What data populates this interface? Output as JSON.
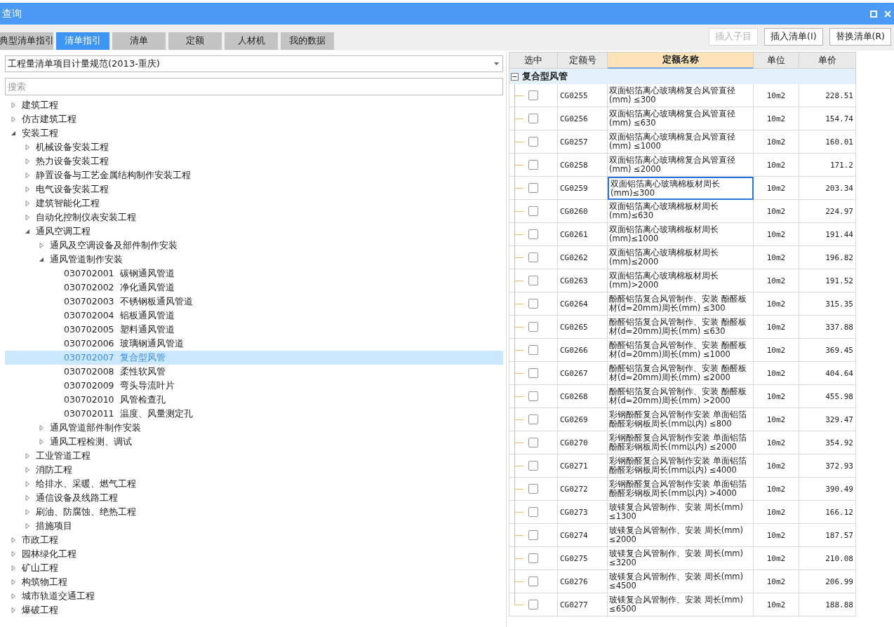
{
  "window": {
    "title": "查询"
  },
  "tabs": [
    {
      "label": "典型清单指引",
      "selected": false
    },
    {
      "label": "清单指引",
      "selected": true
    },
    {
      "label": "清单",
      "selected": false
    },
    {
      "label": "定额",
      "selected": false
    },
    {
      "label": "人材机",
      "selected": false
    },
    {
      "label": "我的数据",
      "selected": false
    }
  ],
  "actions": [
    {
      "label": "插入子目",
      "disabled": true
    },
    {
      "label": "插入清单(I)",
      "disabled": false
    },
    {
      "label": "替换清单(R)",
      "disabled": false
    }
  ],
  "spec_select": {
    "value": "工程量清单项目计量规范(2013-重庆)"
  },
  "search": {
    "placeholder": "搜索"
  },
  "tree": [
    {
      "label": "建筑工程",
      "expanded": false
    },
    {
      "label": "仿古建筑工程",
      "expanded": false
    },
    {
      "label": "安装工程",
      "expanded": true,
      "children": [
        {
          "label": "机械设备安装工程",
          "expanded": false
        },
        {
          "label": "热力设备安装工程",
          "expanded": false
        },
        {
          "label": "静置设备与工艺金属结构制作安装工程",
          "expanded": false
        },
        {
          "label": "电气设备安装工程",
          "expanded": false
        },
        {
          "label": "建筑智能化工程",
          "expanded": false
        },
        {
          "label": "自动化控制仪表安装工程",
          "expanded": false
        },
        {
          "label": "通风空调工程",
          "expanded": true,
          "children": [
            {
              "label": "通风及空调设备及部件制作安装",
              "expanded": false
            },
            {
              "label": "通风管道制作安装",
              "expanded": true,
              "children": [
                {
                  "code": "030702001",
                  "label": "碳钢通风管道",
                  "selected": false
                },
                {
                  "code": "030702002",
                  "label": "净化通风管道",
                  "selected": false
                },
                {
                  "code": "030702003",
                  "label": "不锈钢板通风管道",
                  "selected": false
                },
                {
                  "code": "030702004",
                  "label": "铝板通风管道",
                  "selected": false
                },
                {
                  "code": "030702005",
                  "label": "塑料通风管道",
                  "selected": false
                },
                {
                  "code": "030702006",
                  "label": "玻璃钢通风管道",
                  "selected": false
                },
                {
                  "code": "030702007",
                  "label": "复合型风管",
                  "selected": true
                },
                {
                  "code": "030702008",
                  "label": "柔性软风管",
                  "selected": false
                },
                {
                  "code": "030702009",
                  "label": "弯头导流叶片",
                  "selected": false
                },
                {
                  "code": "030702010",
                  "label": "风管检查孔",
                  "selected": false
                },
                {
                  "code": "030702011",
                  "label": "温度、风量测定孔",
                  "selected": false
                }
              ]
            },
            {
              "label": "通风管道部件制作安装",
              "expanded": false
            },
            {
              "label": "通风工程检测、调试",
              "expanded": false
            }
          ]
        },
        {
          "label": "工业管道工程",
          "expanded": false
        },
        {
          "label": "消防工程",
          "expanded": false
        },
        {
          "label": "给排水、采暖、燃气工程",
          "expanded": false
        },
        {
          "label": "通信设备及线路工程",
          "expanded": false
        },
        {
          "label": "刷油、防腐蚀、绝热工程",
          "expanded": false
        },
        {
          "label": "措施项目",
          "expanded": false
        }
      ]
    },
    {
      "label": "市政工程",
      "expanded": false
    },
    {
      "label": "园林绿化工程",
      "expanded": false
    },
    {
      "label": "矿山工程",
      "expanded": false
    },
    {
      "label": "构筑物工程",
      "expanded": false
    },
    {
      "label": "城市轨道交通工程",
      "expanded": false
    },
    {
      "label": "爆破工程",
      "expanded": false
    }
  ],
  "table": {
    "columns": [
      {
        "label": "选中",
        "highlighted": false
      },
      {
        "label": "定额号",
        "highlighted": false
      },
      {
        "label": "定额名称",
        "highlighted": true
      },
      {
        "label": "单位",
        "highlighted": false
      },
      {
        "label": "单价",
        "highlighted": false
      }
    ],
    "group": {
      "label": "复合型风管",
      "expanded": true
    },
    "rows": [
      {
        "checked": false,
        "code": "CG0255",
        "name": "双面铝箔离心玻璃棉复合风管直径(mm) ≤300",
        "unit": "10m2",
        "price": "228.51",
        "selected": false
      },
      {
        "checked": false,
        "code": "CG0256",
        "name": "双面铝箔离心玻璃棉复合风管直径(mm) ≤630",
        "unit": "10m2",
        "price": "154.74",
        "selected": false
      },
      {
        "checked": false,
        "code": "CG0257",
        "name": "双面铝箔离心玻璃棉复合风管直径(mm) ≤1000",
        "unit": "10m2",
        "price": "160.01",
        "selected": false
      },
      {
        "checked": false,
        "code": "CG0258",
        "name": "双面铝箔离心玻璃棉复合风管直径(mm) ≤2000",
        "unit": "10m2",
        "price": "171.2",
        "selected": false
      },
      {
        "checked": false,
        "code": "CG0259",
        "name": "双面铝箔离心玻璃棉板材周长(mm)≤300",
        "unit": "10m2",
        "price": "203.34",
        "selected": true
      },
      {
        "checked": false,
        "code": "CG0260",
        "name": "双面铝箔离心玻璃棉板材周长(mm)≤630",
        "unit": "10m2",
        "price": "224.97",
        "selected": false
      },
      {
        "checked": false,
        "code": "CG0261",
        "name": "双面铝箔离心玻璃棉板材周长(mm)≤1000",
        "unit": "10m2",
        "price": "191.44",
        "selected": false
      },
      {
        "checked": false,
        "code": "CG0262",
        "name": "双面铝箔离心玻璃棉板材周长(mm)≤2000",
        "unit": "10m2",
        "price": "196.82",
        "selected": false
      },
      {
        "checked": false,
        "code": "CG0263",
        "name": "双面铝箔离心玻璃棉板材周长(mm)>2000",
        "unit": "10m2",
        "price": "191.52",
        "selected": false
      },
      {
        "checked": false,
        "code": "CG0264",
        "name": "酚醛铝箔复合风管制作、安装 酚醛板材(d=20mm)周长(mm) ≤300",
        "unit": "10m2",
        "price": "315.35",
        "selected": false
      },
      {
        "checked": false,
        "code": "CG0265",
        "name": "酚醛铝箔复合风管制作、安装 酚醛板材(d=20mm)周长(mm) ≤630",
        "unit": "10m2",
        "price": "337.88",
        "selected": false
      },
      {
        "checked": false,
        "code": "CG0266",
        "name": "酚醛铝箔复合风管制作、安装 酚醛板材(d=20mm)周长(mm) ≤1000",
        "unit": "10m2",
        "price": "369.45",
        "selected": false
      },
      {
        "checked": false,
        "code": "CG0267",
        "name": "酚醛铝箔复合风管制作、安装 酚醛板材(d=20mm)周长(mm) ≤2000",
        "unit": "10m2",
        "price": "404.64",
        "selected": false
      },
      {
        "checked": false,
        "code": "CG0268",
        "name": "酚醛铝箔复合风管制作、安装 酚醛板材(d=20mm)周长(mm) >2000",
        "unit": "10m2",
        "price": "455.98",
        "selected": false
      },
      {
        "checked": false,
        "code": "CG0269",
        "name": "彩钢酚醛复合风管制作安装 单面铝箔酚醛彩钢板周长(mm以内) ≤800",
        "unit": "10m2",
        "price": "329.47",
        "selected": false
      },
      {
        "checked": false,
        "code": "CG0270",
        "name": "彩钢酚醛复合风管制作安装 单面铝箔酚醛彩钢板周长(mm以内) ≤2000",
        "unit": "10m2",
        "price": "354.92",
        "selected": false
      },
      {
        "checked": false,
        "code": "CG0271",
        "name": "彩钢酚醛复合风管制作安装 单面铝箔酚醛彩钢板周长(mm以内) ≤4000",
        "unit": "10m2",
        "price": "372.93",
        "selected": false
      },
      {
        "checked": false,
        "code": "CG0272",
        "name": "彩钢酚醛复合风管制作安装 单面铝箔酚醛彩钢板周长(mm以内) >4000",
        "unit": "10m2",
        "price": "390.49",
        "selected": false
      },
      {
        "checked": false,
        "code": "CG0273",
        "name": "玻镁复合风管制作、安装 周长(mm) ≤1300",
        "unit": "10m2",
        "price": "166.12",
        "selected": false
      },
      {
        "checked": false,
        "code": "CG0274",
        "name": "玻镁复合风管制作、安装 周长(mm) ≤2000",
        "unit": "10m2",
        "price": "187.57",
        "selected": false
      },
      {
        "checked": false,
        "code": "CG0275",
        "name": "玻镁复合风管制作、安装 周长(mm) ≤3200",
        "unit": "10m2",
        "price": "210.08",
        "selected": false
      },
      {
        "checked": false,
        "code": "CG0276",
        "name": "玻镁复合风管制作、安装 周长(mm) ≤4500",
        "unit": "10m2",
        "price": "206.99",
        "selected": false
      },
      {
        "checked": false,
        "code": "CG0277",
        "name": "玻镁复合风管制作、安装 周长(mm) ≤6500",
        "unit": "10m2",
        "price": "188.88",
        "selected": false
      }
    ]
  }
}
